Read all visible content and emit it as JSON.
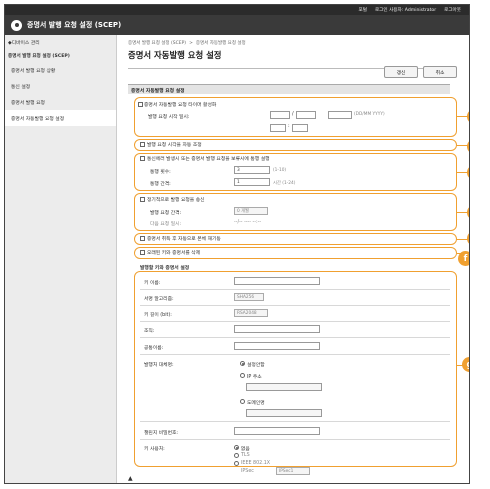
{
  "topbar": {
    "portal": "포털",
    "user": "로그인 사용자: Administrator",
    "logout": "로그아웃"
  },
  "window": {
    "title": "증명서 발행 요청 설정 (SCEP)"
  },
  "sidebar": {
    "back": "◆디바이스 관리",
    "section": "증명서 발행 요청 설정 (SCEP)",
    "items": [
      {
        "label": "증명서 발행 요청 상황"
      },
      {
        "label": "통신 설정"
      },
      {
        "label": "증명서 발행 요청"
      },
      {
        "label": "증명서 자동발행 요청 설정"
      }
    ]
  },
  "breadcrumb": {
    "a": "증명서 발행 요청 설정 (SCEP)",
    "b": "증명서 자동발행 요청 설정"
  },
  "page_title": "증명서 자동발행 요청 설정",
  "buttons": {
    "ok": "갱신",
    "cancel": "취소"
  },
  "sections": {
    "auto_request": "증명서 자동발행 요청 설정",
    "key_cert": "발행할 키와 증명서 설정"
  },
  "form": {
    "enable_timer": "증명서 자동발행 요청 타이머 활성화",
    "start_time_label": "발행 요청 시작 일시:",
    "date_sep": "/",
    "date_hint": "(DD/MM YYYY)",
    "time_sep": ":",
    "auto_adjust": "발행 요청 시각을 자동 조정",
    "retry_on_error": "통신에러 발생시 또는 증명서 발행 요청을 보류시에 통행 설행",
    "retry_count_label": "통행 횟수:",
    "retry_count": "3",
    "retry_count_hint": "(1-10)",
    "retry_interval_label": "통행 간격:",
    "retry_interval": "1",
    "retry_interval_unit": "시간 (1-24)",
    "periodic": "정기적으로 발행 요청을 송신",
    "periodic_interval_label": "발행 요청 간격:",
    "periodic_interval": "0 개월",
    "next_time_label": "다음 요청 일시:",
    "next_time_value": "--/-- ---- --:--",
    "auto_restart": "증명서 취득 후 자동으로 본체 재기동",
    "delete_old": "오래된 키와 증명서를 삭제",
    "key_name": "키 이름:",
    "sig_algo": "서명 알고리즘:",
    "sig_algo_value": "SHA256",
    "key_len": "키 길이 (bit):",
    "key_len_value": "RSA2048",
    "org": "조직:",
    "common_name": "공통이름:",
    "subject_alt": "발행처 대체명:",
    "none_opt": "설정안함",
    "ip_opt": "IP 주소",
    "domain_opt": "도메인명",
    "challenge_pw": "챌린지 비밀번호:",
    "key_usage": "키 사용처:",
    "usage_none": "없음",
    "usage_tls": "TLS",
    "usage_8021x": "IEEE 802.1X",
    "usage_ipsec": "IPSec",
    "ipsec_value": "IPSec1"
  },
  "badges": [
    "a",
    "b",
    "c",
    "d",
    "e",
    "f",
    "g"
  ],
  "colors": {
    "accent": "#f0a030",
    "topbar": "#2b2b2b",
    "titlebar": "#3a3a3a"
  }
}
